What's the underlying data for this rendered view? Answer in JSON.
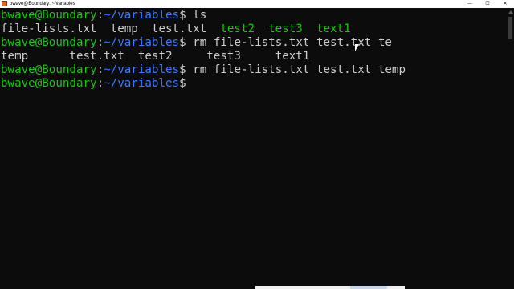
{
  "window": {
    "title": "bwave@Boundary: ~/variables",
    "controls": {
      "minimize": "—",
      "maximize": "☐",
      "close": "✕"
    }
  },
  "colors": {
    "background": "#0c0c0c",
    "text": "#cccccc",
    "user": "#16c60c",
    "path": "#3b78ff",
    "directory": "#16c60c"
  },
  "prompt": {
    "user_host": "bwave@Boundary",
    "separator": ":",
    "path": "~/variables",
    "symbol": "$ "
  },
  "lines": [
    {
      "type": "prompt",
      "command": "ls"
    },
    {
      "type": "output",
      "segments": [
        {
          "text": "file-lists.txt  ",
          "kind": "file"
        },
        {
          "text": "temp  ",
          "kind": "file"
        },
        {
          "text": "test.txt  ",
          "kind": "file"
        },
        {
          "text": "test2  ",
          "kind": "dir"
        },
        {
          "text": "test3  ",
          "kind": "dir"
        },
        {
          "text": "text1",
          "kind": "dir"
        }
      ]
    },
    {
      "type": "prompt",
      "command": "rm file-lists.txt test.txt te"
    },
    {
      "type": "output",
      "segments": [
        {
          "text": "temp      ",
          "kind": "file"
        },
        {
          "text": "test.txt  ",
          "kind": "file"
        },
        {
          "text": "test2     ",
          "kind": "file"
        },
        {
          "text": "test3     ",
          "kind": "file"
        },
        {
          "text": "text1",
          "kind": "file"
        }
      ]
    },
    {
      "type": "prompt",
      "command": "rm file-lists.txt test.txt temp"
    },
    {
      "type": "prompt",
      "command": ""
    }
  ]
}
